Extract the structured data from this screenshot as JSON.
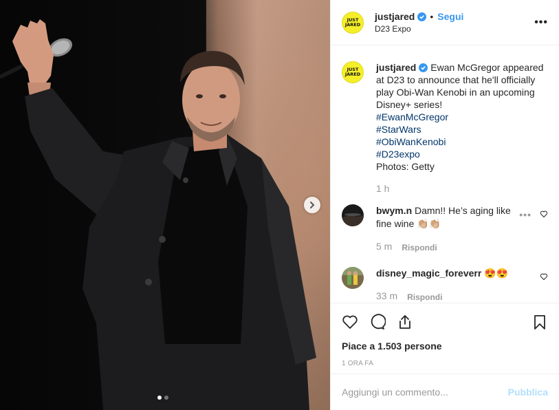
{
  "post": {
    "username": "justjared",
    "avatar_text": [
      "JUST",
      "JARED"
    ],
    "follow_label": "Segui",
    "separator": "•",
    "location": "D23 Expo",
    "more_label": "•••",
    "caption": {
      "text": "Ewan McGregor appeared at D23 to announce that he'll officially play Obi-Wan Kenobi in an upcoming Disney+ series!",
      "hashtags": [
        "#EwanMcGregor",
        "#StarWars",
        "#ObiWanKenobi",
        "#D23expo"
      ],
      "credit": "Photos: Getty",
      "time": "1 h"
    },
    "comments": [
      {
        "username": "bwym.n",
        "text": "Damn!! He’s aging like fine wine 👏🏼👏🏼",
        "time": "5 m",
        "reply_label": "Rispondi",
        "more": "•••"
      },
      {
        "username": "disney_magic_foreverr",
        "text": "😍😍",
        "time": "33 m",
        "reply_label": "Rispondi"
      }
    ],
    "likes_text": "Piace a 1.503 persone",
    "posted_ago": "1 ORA FA",
    "comment_placeholder": "Aggiungi un commento...",
    "publish_label": "Pubblica",
    "carousel": {
      "total": 2,
      "current": 1
    }
  },
  "colors": {
    "accent": "#3897f0",
    "hashtag": "#003569",
    "muted": "#999999",
    "publish_disabled": "#b2dffc",
    "avatar_yellow": "#f5ef2a"
  },
  "icons": [
    "verified-icon",
    "chevron-right-icon",
    "heart-icon",
    "comment-icon",
    "share-icon",
    "bookmark-icon",
    "more-icon"
  ]
}
